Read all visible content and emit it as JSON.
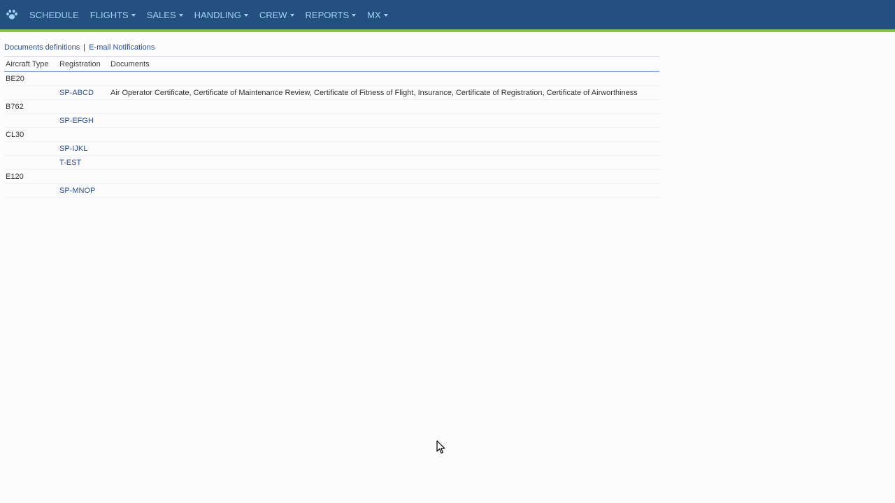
{
  "nav": {
    "logo_icon": "paw-icon",
    "items": [
      {
        "label": "SCHEDULE",
        "has_dropdown": false
      },
      {
        "label": "FLIGHTS",
        "has_dropdown": true
      },
      {
        "label": "SALES",
        "has_dropdown": true
      },
      {
        "label": "HANDLING",
        "has_dropdown": true
      },
      {
        "label": "CREW",
        "has_dropdown": true
      },
      {
        "label": "REPORTS",
        "has_dropdown": true
      },
      {
        "label": "MX",
        "has_dropdown": true
      }
    ]
  },
  "subnav": {
    "documents_definitions": "Documents definitions",
    "separator": "|",
    "email_notifications": "E-mail Notifications"
  },
  "table": {
    "headers": [
      "Aircraft Type",
      "Registration",
      "Documents"
    ],
    "rows": [
      {
        "type": "BE20",
        "registration": "",
        "documents": ""
      },
      {
        "type": "",
        "registration": "SP-ABCD",
        "documents": "Air Operator Certificate, Certificate of Maintenance Review, Certificate of Fitness of Flight, Insurance, Certificate of Registration, Certificate of Airworthiness"
      },
      {
        "type": "B762",
        "registration": "",
        "documents": ""
      },
      {
        "type": "",
        "registration": "SP-EFGH",
        "documents": ""
      },
      {
        "type": "CL30",
        "registration": "",
        "documents": ""
      },
      {
        "type": "",
        "registration": "SP-IJKL",
        "documents": ""
      },
      {
        "type": "",
        "registration": "T-EST",
        "documents": ""
      },
      {
        "type": "E120",
        "registration": "",
        "documents": ""
      },
      {
        "type": "",
        "registration": "SP-MNOP",
        "documents": ""
      }
    ]
  },
  "colors": {
    "topbar": "#23507f",
    "accent_border": "#8cc63f",
    "nav_text": "#9fd0f7",
    "link": "#2a4fa8"
  }
}
